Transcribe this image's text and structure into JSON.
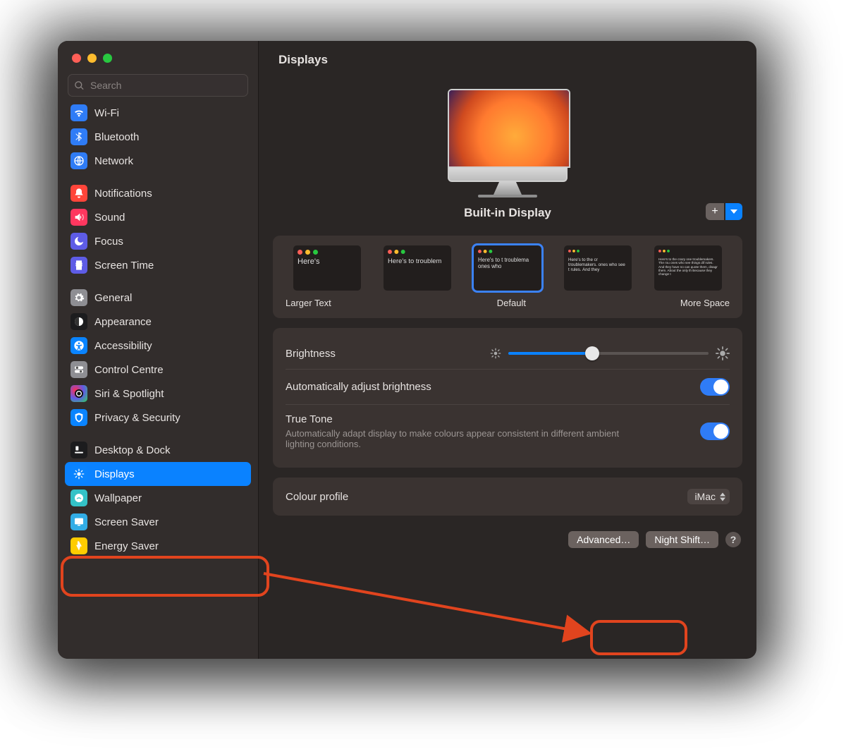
{
  "window": {
    "title": "Displays"
  },
  "search": {
    "placeholder": "Search"
  },
  "sidebar": {
    "groups": [
      {
        "items": [
          {
            "id": "wifi",
            "label": "Wi-Fi",
            "icon": "wifi",
            "cutoff": true
          },
          {
            "id": "bluetooth",
            "label": "Bluetooth",
            "icon": "bt"
          },
          {
            "id": "network",
            "label": "Network",
            "icon": "net"
          }
        ]
      },
      {
        "items": [
          {
            "id": "notifications",
            "label": "Notifications",
            "icon": "notif"
          },
          {
            "id": "sound",
            "label": "Sound",
            "icon": "sound"
          },
          {
            "id": "focus",
            "label": "Focus",
            "icon": "focus"
          },
          {
            "id": "screentime",
            "label": "Screen Time",
            "icon": "screentime"
          }
        ]
      },
      {
        "items": [
          {
            "id": "general",
            "label": "General",
            "icon": "general"
          },
          {
            "id": "appearance",
            "label": "Appearance",
            "icon": "appearance"
          },
          {
            "id": "accessibility",
            "label": "Accessibility",
            "icon": "access"
          },
          {
            "id": "controlcentre",
            "label": "Control Centre",
            "icon": "cc"
          },
          {
            "id": "siri",
            "label": "Siri & Spotlight",
            "icon": "siri"
          },
          {
            "id": "privacy",
            "label": "Privacy & Security",
            "icon": "privacy"
          }
        ]
      },
      {
        "items": [
          {
            "id": "desktop",
            "label": "Desktop & Dock",
            "icon": "desktop"
          },
          {
            "id": "displays",
            "label": "Displays",
            "icon": "displays",
            "selected": true
          },
          {
            "id": "wallpaper",
            "label": "Wallpaper",
            "icon": "wallpaper"
          },
          {
            "id": "screensaver",
            "label": "Screen Saver",
            "icon": "ss"
          },
          {
            "id": "energy",
            "label": "Energy Saver",
            "icon": "energy"
          }
        ]
      }
    ]
  },
  "hero": {
    "display_name": "Built-in Display"
  },
  "resolution": {
    "left_caption": "Larger Text",
    "center_caption": "Default",
    "right_caption": "More Space",
    "thumbs": [
      {
        "text": "Here's"
      },
      {
        "text": "Here's to troublem"
      },
      {
        "text": "Here's to t troublema ones who",
        "selected": true
      },
      {
        "text": "Here's to the cr troublemakers. ones who see t rules. And they"
      },
      {
        "text": "Here's to the crazy one troublemakers. The rou ones who see things dif rules. And they have no can quote them, disagr them. About the only th Because they change t"
      }
    ]
  },
  "rows": {
    "brightness_label": "Brightness",
    "auto_label": "Automatically adjust brightness",
    "truetone_label": "True Tone",
    "truetone_sub": "Automatically adapt display to make colours appear consistent in different ambient lighting conditions.",
    "colour_label": "Colour profile",
    "colour_value": "iMac"
  },
  "footer": {
    "advanced": "Advanced…",
    "nightshift": "Night Shift…"
  }
}
